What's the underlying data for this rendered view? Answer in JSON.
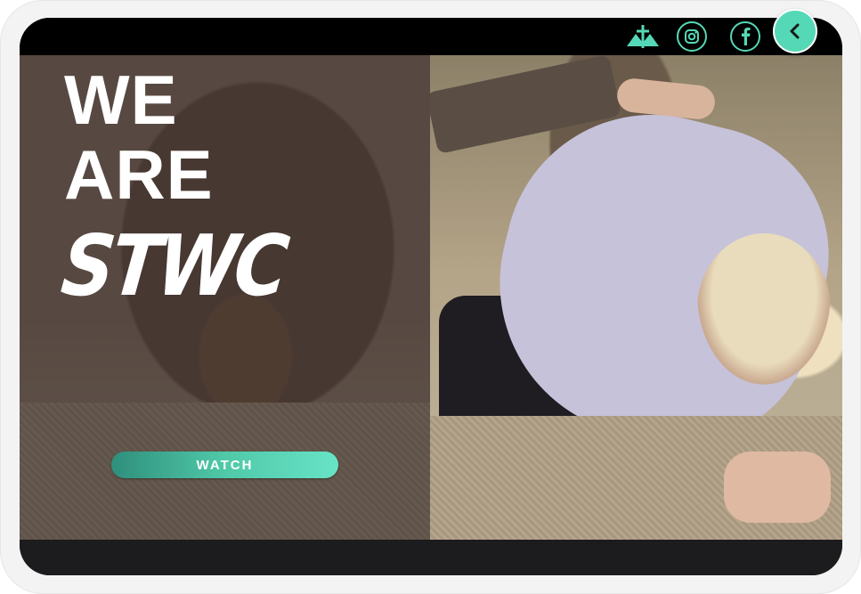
{
  "hero": {
    "headline_line1": "WE",
    "headline_line2": "ARE",
    "brand": "STWC",
    "watch_label": "WATCH"
  },
  "topbar": {
    "icons": [
      "church-logo-icon",
      "instagram-icon",
      "facebook-icon"
    ]
  },
  "back_button": {
    "icon": "chevron-left-icon"
  },
  "colors": {
    "accent": "#55d8b5",
    "accent_dark": "#2f8f7c",
    "topbar": "#000000",
    "bottombar": "#1c1c1e",
    "overlay": "#463732"
  }
}
